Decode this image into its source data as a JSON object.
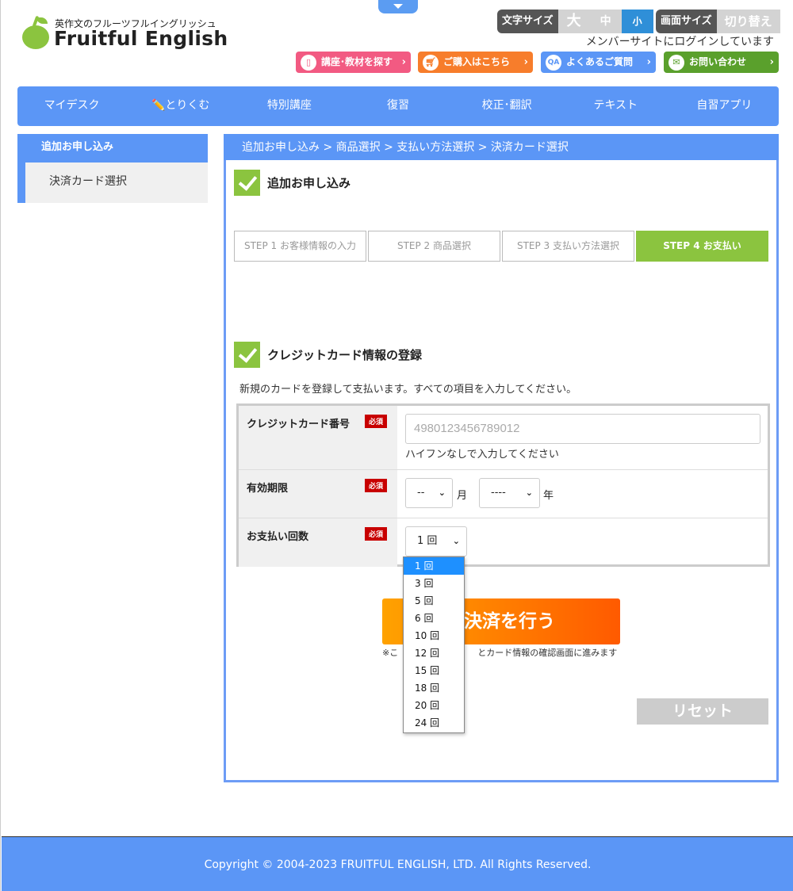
{
  "header": {
    "logo_sub": "英作文のフルーツフルイングリッシュ",
    "logo_main": "Fruitful English",
    "font_size_label": "文字サイズ",
    "font_size_large": "大",
    "font_size_medium": "中",
    "font_size_small": "小",
    "screen_size_label": "画面サイズ",
    "screen_size_switch": "切り替え",
    "login_message": "メンバーサイトにログインしています",
    "buttons": {
      "search_courses": "講座･教材を探す",
      "purchase": "ご購入はこちら",
      "faq": "よくあるご質問",
      "contact": "お問い合わせ"
    }
  },
  "nav": {
    "items": [
      "マイデスク",
      "とりくむ",
      "特別講座",
      "復習",
      "校正･翻訳",
      "テキスト",
      "自習アプリ"
    ]
  },
  "sidebar": {
    "heading": "追加お申し込み",
    "items": [
      "決済カード選択"
    ]
  },
  "breadcrumb": "追加お申し込み > 商品選択 > 支払い方法選択 > 決済カード選択",
  "section1_title": "追加お申し込み",
  "steps": [
    {
      "num": "STEP 1",
      "label": "お客様情報の入力"
    },
    {
      "num": "STEP 2",
      "label": "商品選択"
    },
    {
      "num": "STEP 3",
      "label": "支払い方法選択"
    },
    {
      "num": "STEP 4",
      "label": "お支払い"
    }
  ],
  "section2_title": "クレジットカード情報の登録",
  "description": "新規のカードを登録して支払います。すべての項目を入力してください。",
  "form": {
    "required_label": "必須",
    "card_number_label": "クレジットカード番号",
    "card_number_placeholder": "4980123456789012",
    "card_number_hint": "ハイフンなしで入力してください",
    "expiry_label": "有効期限",
    "expiry_month_value": "--",
    "expiry_month_unit": "月",
    "expiry_year_value": "----",
    "expiry_year_unit": "年",
    "installments_label": "お支払い回数",
    "installments_value": "1 回",
    "installments_options": [
      "1 回",
      "3 回",
      "5 回",
      "6 回",
      "10 回",
      "12 回",
      "15 回",
      "18 回",
      "20 回",
      "24 回"
    ]
  },
  "pay_button": "決済を行う",
  "pay_note": "※こ",
  "pay_note_rest": "とカード情報の確認画面に進みます",
  "reset_button": "リセット",
  "footer": "Copyright © 2004-2023 FRUITFUL ENGLISH, LTD. All Rights Reserved.",
  "colors": {
    "primary_blue": "#5b96f6",
    "green": "#8bc43f",
    "orange": "#ff7a00",
    "required_red": "#c80000"
  }
}
